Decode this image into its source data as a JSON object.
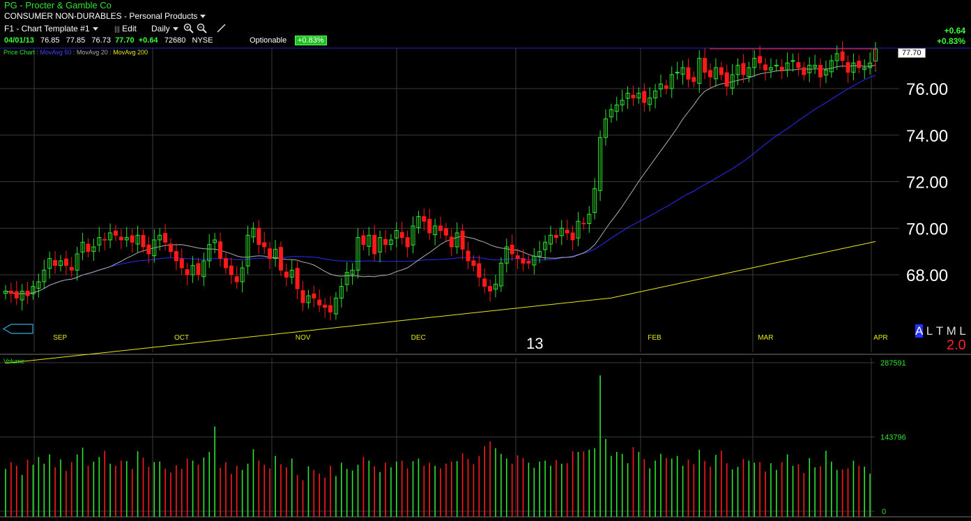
{
  "header": {
    "title": "PG - Procter & Gamble Co",
    "sector": "CONSUMER NON-DURABLES",
    "industry": "Personal Products",
    "template": "F1 - Chart Template #1",
    "edit_label": "Edit",
    "period": "Daily",
    "quote": {
      "date": "04/01/13",
      "open": "76.85",
      "high": "77.85",
      "low": "76.73",
      "close": "77.70",
      "change": "+0.64",
      "volume": "72680",
      "exchange": "NYSE",
      "optionable": "Optionable",
      "pct": "+0.83%"
    },
    "right_change": "+0.64",
    "right_pct": "+0.83%"
  },
  "indicators": {
    "price_chart": "Price Chart",
    "ma50": "MovAvg 50",
    "ma20": "MovAvg 20",
    "ma200": "MovAvg 200"
  },
  "price_label": "77.70",
  "year_label": "13",
  "alt_menu": [
    "A",
    "L",
    "T",
    "M",
    "L"
  ],
  "alt_selected": 0,
  "alt_value": "2.0",
  "volume_label": "Volume",
  "colors": {
    "up": "#2ee62e",
    "down": "#ff1a1a",
    "ma50": "#2b2bff",
    "ma20": "#b0b0b0",
    "ma200": "#e8e81a",
    "grid": "#3a3a3a"
  },
  "chart_data": {
    "type": "candlestick",
    "y_ticks": [
      "76.00",
      "74.00",
      "72.00",
      "70.00",
      "68.00"
    ],
    "y_tick_values": [
      76,
      74,
      72,
      70,
      68
    ],
    "ylim": [
      65.9,
      77.85
    ],
    "month_labels": [
      "SEP",
      "OCT",
      "NOV",
      "DEC",
      "FEB",
      "MAR",
      "APR"
    ],
    "month_positions_index": [
      8,
      30,
      52,
      73,
      116,
      136,
      157
    ],
    "volume_ticks": [
      "287591",
      "143796",
      "0"
    ],
    "volume_tick_values": [
      287591,
      143796,
      0
    ],
    "close": [
      67.3,
      67.2,
      67.0,
      67.3,
      67.1,
      67.5,
      67.7,
      68.2,
      68.7,
      68.4,
      68.6,
      68.4,
      68.2,
      68.9,
      69.4,
      69.0,
      69.2,
      69.6,
      69.5,
      69.8,
      69.7,
      69.5,
      69.6,
      69.4,
      69.7,
      69.2,
      68.9,
      69.5,
      69.7,
      69.4,
      69.0,
      68.6,
      68.3,
      68.0,
      68.4,
      68.0,
      68.6,
      69.3,
      69.5,
      68.7,
      68.3,
      68.0,
      67.7,
      68.3,
      69.7,
      70.0,
      69.3,
      69.2,
      68.7,
      69.1,
      68.2,
      67.9,
      68.2,
      67.4,
      66.8,
      67.1,
      67.0,
      66.7,
      66.6,
      66.4,
      67.0,
      67.5,
      68.1,
      68.2,
      69.6,
      69.3,
      69.7,
      68.9,
      69.6,
      69.3,
      69.5,
      69.9,
      69.6,
      69.2,
      70.1,
      70.5,
      70.3,
      69.8,
      70.1,
      69.9,
      69.7,
      69.2,
      69.8,
      69.1,
      68.6,
      68.4,
      67.9,
      67.5,
      67.3,
      67.6,
      68.5,
      69.2,
      68.9,
      68.7,
      68.5,
      68.5,
      68.8,
      69.0,
      69.4,
      69.7,
      69.6,
      70.0,
      69.8,
      69.5,
      70.3,
      70.2,
      70.6,
      71.7,
      73.9,
      74.7,
      75.1,
      75.3,
      75.5,
      75.8,
      75.6,
      75.8,
      75.4,
      75.6,
      75.9,
      76.2,
      76.0,
      76.6,
      76.7,
      76.9,
      76.4,
      76.3,
      77.3,
      76.7,
      76.5,
      76.9,
      76.6,
      76.1,
      76.6,
      77.0,
      76.6,
      76.9,
      77.3,
      77.1,
      76.8,
      76.9,
      77.0,
      76.8,
      77.1,
      77.2,
      76.9,
      76.6,
      77.0,
      77.0,
      76.5,
      76.8,
      77.2,
      77.5,
      77.2,
      76.7,
      77.1,
      76.9,
      76.9,
      77.1,
      77.7
    ],
    "volume": [
      82000,
      95000,
      88000,
      70000,
      100000,
      90000,
      105000,
      92000,
      110000,
      85000,
      100000,
      78000,
      95000,
      110000,
      123000,
      88000,
      96000,
      105000,
      117000,
      92000,
      88000,
      98000,
      97000,
      82000,
      116000,
      104000,
      86000,
      95000,
      96000,
      82000,
      75000,
      89000,
      82000,
      102000,
      98000,
      90000,
      104000,
      115000,
      164000,
      84000,
      95000,
      72000,
      88000,
      80000,
      92000,
      120000,
      98000,
      90000,
      83000,
      107000,
      91000,
      85000,
      102000,
      70000,
      60000,
      87000,
      80000,
      73000,
      65000,
      88000,
      68000,
      94000,
      82000,
      79000,
      90000,
      105000,
      98000,
      87000,
      76000,
      94000,
      85000,
      96000,
      98000,
      83000,
      97000,
      102000,
      88000,
      94000,
      88000,
      83000,
      92000,
      96000,
      97000,
      112000,
      101000,
      91000,
      107000,
      126000,
      135000,
      122000,
      111000,
      102000,
      92000,
      108000,
      103000,
      94000,
      84000,
      96000,
      98000,
      88000,
      99000,
      92000,
      93000,
      116000,
      115000,
      116000,
      119000,
      122000,
      263000,
      140000,
      107000,
      115000,
      111000,
      93000,
      124000,
      115000,
      101000,
      83000,
      98000,
      111000,
      103000,
      102000,
      107000,
      88000,
      100000,
      91000,
      119000,
      97000,
      86000,
      109000,
      117000,
      93000,
      81000,
      86000,
      101000,
      98000,
      94000,
      95000,
      77000,
      93000,
      80000,
      95000,
      110000,
      88000,
      91000,
      74000,
      103000,
      85000,
      87000,
      117000,
      96000,
      80000,
      81000,
      83000,
      98000,
      88000,
      86000,
      72680
    ]
  }
}
